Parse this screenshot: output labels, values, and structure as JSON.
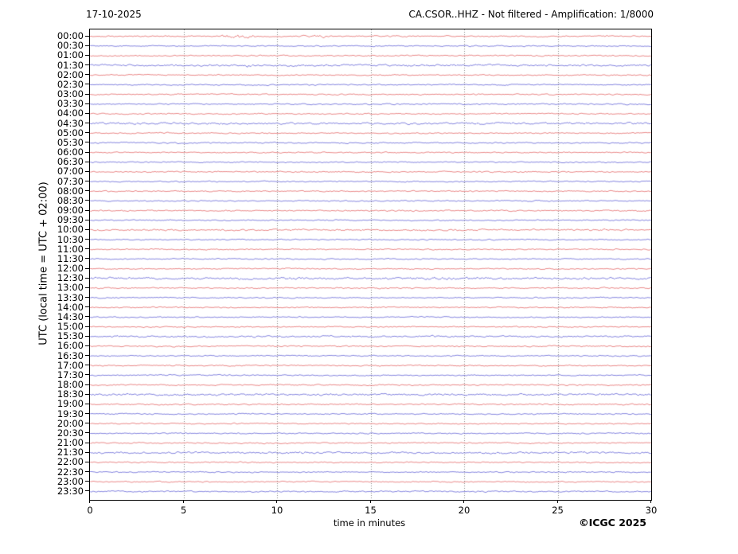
{
  "chart_data": {
    "type": "line",
    "subtype": "helicorder-seismogram",
    "date_label": "17-10-2025",
    "title": "CA.CSOR..HHZ - Not filtered - Amplification: 1/8000",
    "xlabel": "time in minutes",
    "ylabel": "UTC (local time = UTC + 02:00)",
    "credit": "©ICGC 2025",
    "xlim": [
      0,
      30
    ],
    "x_ticks": [
      0,
      5,
      10,
      15,
      20,
      25,
      30
    ],
    "grid_ticks": [
      5,
      10,
      15,
      20,
      25
    ],
    "grid_style": "dotted",
    "row_interval_minutes": 30,
    "palette": {
      "r": "#e05050",
      "b": "#4a4ad0"
    },
    "frame_color": "#000000",
    "grid_color": "#666666",
    "rows": [
      {
        "t": "00:00",
        "c": "r",
        "a": 0.75
      },
      {
        "t": "00:30",
        "c": "b",
        "a": 0.7
      },
      {
        "t": "01:00",
        "c": "r",
        "a": 0.7
      },
      {
        "t": "01:30",
        "c": "b",
        "a": 1.1
      },
      {
        "t": "02:00",
        "c": "r",
        "a": 0.7
      },
      {
        "t": "02:30",
        "c": "b",
        "a": 0.7
      },
      {
        "t": "03:00",
        "c": "r",
        "a": 0.7
      },
      {
        "t": "03:30",
        "c": "b",
        "a": 0.7
      },
      {
        "t": "04:00",
        "c": "r",
        "a": 0.7
      },
      {
        "t": "04:30",
        "c": "b",
        "a": 1.1
      },
      {
        "t": "05:00",
        "c": "r",
        "a": 0.7
      },
      {
        "t": "05:30",
        "c": "b",
        "a": 0.75
      },
      {
        "t": "06:00",
        "c": "r",
        "a": 0.7
      },
      {
        "t": "06:30",
        "c": "b",
        "a": 0.7
      },
      {
        "t": "07:00",
        "c": "r",
        "a": 0.75
      },
      {
        "t": "07:30",
        "c": "b",
        "a": 0.7
      },
      {
        "t": "08:00",
        "c": "r",
        "a": 0.7
      },
      {
        "t": "08:30",
        "c": "b",
        "a": 0.7
      },
      {
        "t": "09:00",
        "c": "r",
        "a": 0.8
      },
      {
        "t": "09:30",
        "c": "b",
        "a": 0.7
      },
      {
        "t": "10:00",
        "c": "r",
        "a": 1.0
      },
      {
        "t": "10:30",
        "c": "b",
        "a": 0.7
      },
      {
        "t": "11:00",
        "c": "r",
        "a": 0.7
      },
      {
        "t": "11:30",
        "c": "b",
        "a": 0.7
      },
      {
        "t": "12:00",
        "c": "r",
        "a": 0.7
      },
      {
        "t": "12:30",
        "c": "b",
        "a": 1.2
      },
      {
        "t": "13:00",
        "c": "r",
        "a": 0.75
      },
      {
        "t": "13:30",
        "c": "b",
        "a": 0.7
      },
      {
        "t": "14:00",
        "c": "r",
        "a": 0.7
      },
      {
        "t": "14:30",
        "c": "b",
        "a": 0.7
      },
      {
        "t": "15:00",
        "c": "r",
        "a": 0.7
      },
      {
        "t": "15:30",
        "c": "b",
        "a": 0.95
      },
      {
        "t": "16:00",
        "c": "r",
        "a": 0.7
      },
      {
        "t": "16:30",
        "c": "b",
        "a": 0.7
      },
      {
        "t": "17:00",
        "c": "r",
        "a": 0.7
      },
      {
        "t": "17:30",
        "c": "b",
        "a": 0.7
      },
      {
        "t": "18:00",
        "c": "r",
        "a": 0.7
      },
      {
        "t": "18:30",
        "c": "b",
        "a": 1.1
      },
      {
        "t": "19:00",
        "c": "r",
        "a": 0.75
      },
      {
        "t": "19:30",
        "c": "b",
        "a": 0.7
      },
      {
        "t": "20:00",
        "c": "r",
        "a": 0.7
      },
      {
        "t": "20:30",
        "c": "b",
        "a": 0.7
      },
      {
        "t": "21:00",
        "c": "r",
        "a": 0.7
      },
      {
        "t": "21:30",
        "c": "b",
        "a": 1.1
      },
      {
        "t": "22:00",
        "c": "r",
        "a": 0.75
      },
      {
        "t": "22:30",
        "c": "b",
        "a": 0.7
      },
      {
        "t": "23:00",
        "c": "r",
        "a": 0.7
      },
      {
        "t": "23:30",
        "c": "b",
        "a": 0.75
      }
    ],
    "events": [
      {
        "row": 0,
        "from": 7.0,
        "to": 8.8,
        "amp": 1.9
      },
      {
        "row": 0,
        "from": 11.2,
        "to": 12.6,
        "amp": 1.4
      },
      {
        "row": 0,
        "from": 15.9,
        "to": 17.3,
        "amp": 1.0
      },
      {
        "row": 3,
        "from": 8.25,
        "to": 8.6,
        "amp": 2.3
      },
      {
        "row": 25,
        "from": 16.5,
        "to": 21.0,
        "amp": 1.5
      }
    ]
  }
}
